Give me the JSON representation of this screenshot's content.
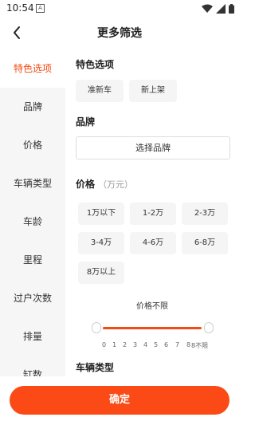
{
  "status_bar": {
    "time": "10:54",
    "notification_glyph": "A",
    "icons": [
      "wifi-icon",
      "signal-icon",
      "battery-icon"
    ]
  },
  "header": {
    "title": "更多筛选",
    "back_icon": "chevron-left-icon"
  },
  "sidebar": {
    "items": [
      {
        "label": "特色选项",
        "active": true
      },
      {
        "label": "品牌"
      },
      {
        "label": "价格"
      },
      {
        "label": "车辆类型"
      },
      {
        "label": "车龄"
      },
      {
        "label": "里程"
      },
      {
        "label": "过户次数"
      },
      {
        "label": "排量"
      },
      {
        "label": "缸数"
      }
    ]
  },
  "features": {
    "title": "特色选项",
    "options": [
      "准新车",
      "新上架"
    ]
  },
  "brand": {
    "title": "品牌",
    "select_label": "选择品牌"
  },
  "price": {
    "title": "价格",
    "unit": "（万元）",
    "options": [
      "1万以下",
      "1-2万",
      "2-3万",
      "3-4万",
      "4-6万",
      "6-8万",
      "8万以上"
    ],
    "range_label": "价格不限",
    "ticks": [
      "0",
      "1",
      "2",
      "3",
      "4",
      "5",
      "6",
      "7",
      "8",
      "8不限"
    ]
  },
  "vehicle_type": {
    "title": "车辆类型"
  },
  "footer": {
    "confirm_label": "确定"
  },
  "colors": {
    "accent": "#f24c14",
    "button": "#fb4a16",
    "sidebar_bg": "#f6f6f6",
    "chip_bg": "#f5f5f5"
  }
}
